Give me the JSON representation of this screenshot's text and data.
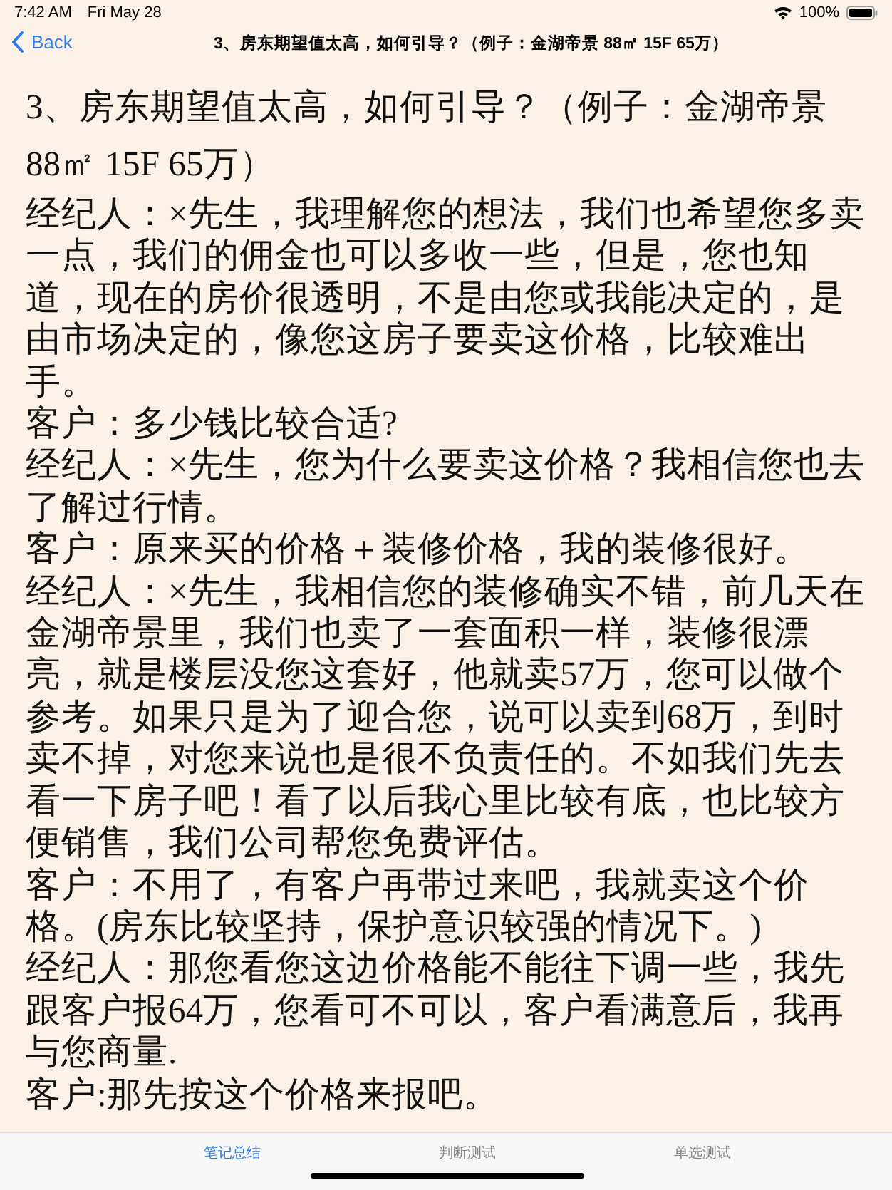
{
  "status_bar": {
    "time": "7:42 AM",
    "date": "Fri May 28",
    "battery": "100%"
  },
  "nav_bar": {
    "back": "Back",
    "title": "3、房东期望值太高，如何引导？（例子：金湖帝景 88㎡ 15F 65万）"
  },
  "article": {
    "heading": "3、房东期望值太高，如何引导？（例子：金湖帝景88㎡ 15F 65万）",
    "paragraphs": [
      "经纪人：×先生，我理解您的想法，我们也希望您多卖一点，我们的佣金也可以多收一些，但是，您也知道，现在的房价很透明，不是由您或我能决定的，是由市场决定的，像您这房子要卖这价格，比较难出手。",
      "客户：多少钱比较合适?",
      "经纪人：×先生，您为什么要卖这价格？我相信您也去了解过行情。",
      "客户：原来买的价格＋装修价格，我的装修很好。",
      "经纪人：×先生，我相信您的装修确实不错，前几天在金湖帝景里，我们也卖了一套面积一样，装修很漂亮，就是楼层没您这套好，他就卖57万，您可以做个参考。如果只是为了迎合您，说可以卖到68万，到时卖不掉，对您来说也是很不负责任的。不如我们先去看一下房子吧！看了以后我心里比较有底，也比较方便销售，我们公司帮您免费评估。",
      "客户：不用了，有客户再带过来吧，我就卖这个价格。(房东比较坚持，保护意识较强的情况下。)",
      "经纪人：那您看您这边价格能不能往下调一些，我先跟客户报64万，您看可不可以，客户看满意后，我再与您商量.",
      "客户:那先按这个价格来报吧。"
    ]
  },
  "tab_bar": {
    "tabs": [
      {
        "label": "笔记总结",
        "selected": true
      },
      {
        "label": "判断测试",
        "selected": false
      },
      {
        "label": "单选测试",
        "selected": false
      }
    ]
  }
}
